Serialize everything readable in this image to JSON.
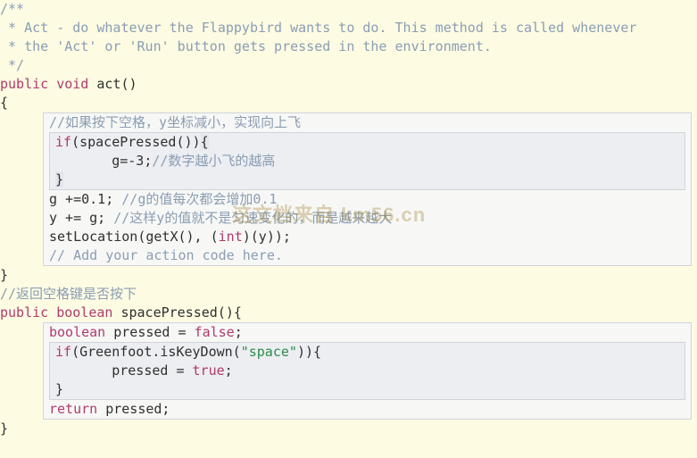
{
  "doc": {
    "l1": "/**",
    "l2": " * Act - do whatever the Flappybird wants to do. This method is called whenever",
    "l3": " * the 'Act' or 'Run' button gets pressed in the environment.",
    "l4": " */"
  },
  "act": {
    "kw_public": "public",
    "kw_void": "void",
    "name": "act",
    "sig_paren": "()",
    "open_brace": "{",
    "close_brace": "}",
    "cmt_space": "//如果按下空格，y坐标减小，实现向上飞",
    "if_kw": "if",
    "if_cond": "(spacePressed())",
    "if_open": "{",
    "g_assign_l": "g=",
    "g_assign_v": "-3",
    "g_assign_semi": ";",
    "g_assign_cmt": "//数字越小飞的越高",
    "if_close": "}",
    "g_inc": "g +=0.1; ",
    "g_inc_cmt": "//g的值每次都会增加0.1",
    "y_inc": "y += g; ",
    "y_inc_cmt": "//这样y的值就不是匀速变化的，而是越来越大",
    "setloc_a": "setLocation(getX(), (",
    "setloc_cast": "int",
    "setloc_b": ")(y));",
    "add_cmt": "// Add your action code here."
  },
  "sp": {
    "cmt_ret": "//返回空格键是否按下",
    "kw_public": "public",
    "kw_boolean": "boolean",
    "name": "spacePressed",
    "sig_paren": "(){",
    "decl_type": "boolean",
    "decl_name": " pressed = ",
    "decl_false": "false",
    "decl_semi": ";",
    "if_kw": "if",
    "if_a": "(Greenfoot.isKeyDown(",
    "if_str": "\"space\"",
    "if_b": ")){",
    "set_true_a": "pressed = ",
    "set_true_v": "true",
    "set_true_semi": ";",
    "if_close": "}",
    "ret_kw": "return",
    "ret_rest": " pressed;",
    "close_brace": "}"
  },
  "watermark": "这文档来自 km56.cn"
}
